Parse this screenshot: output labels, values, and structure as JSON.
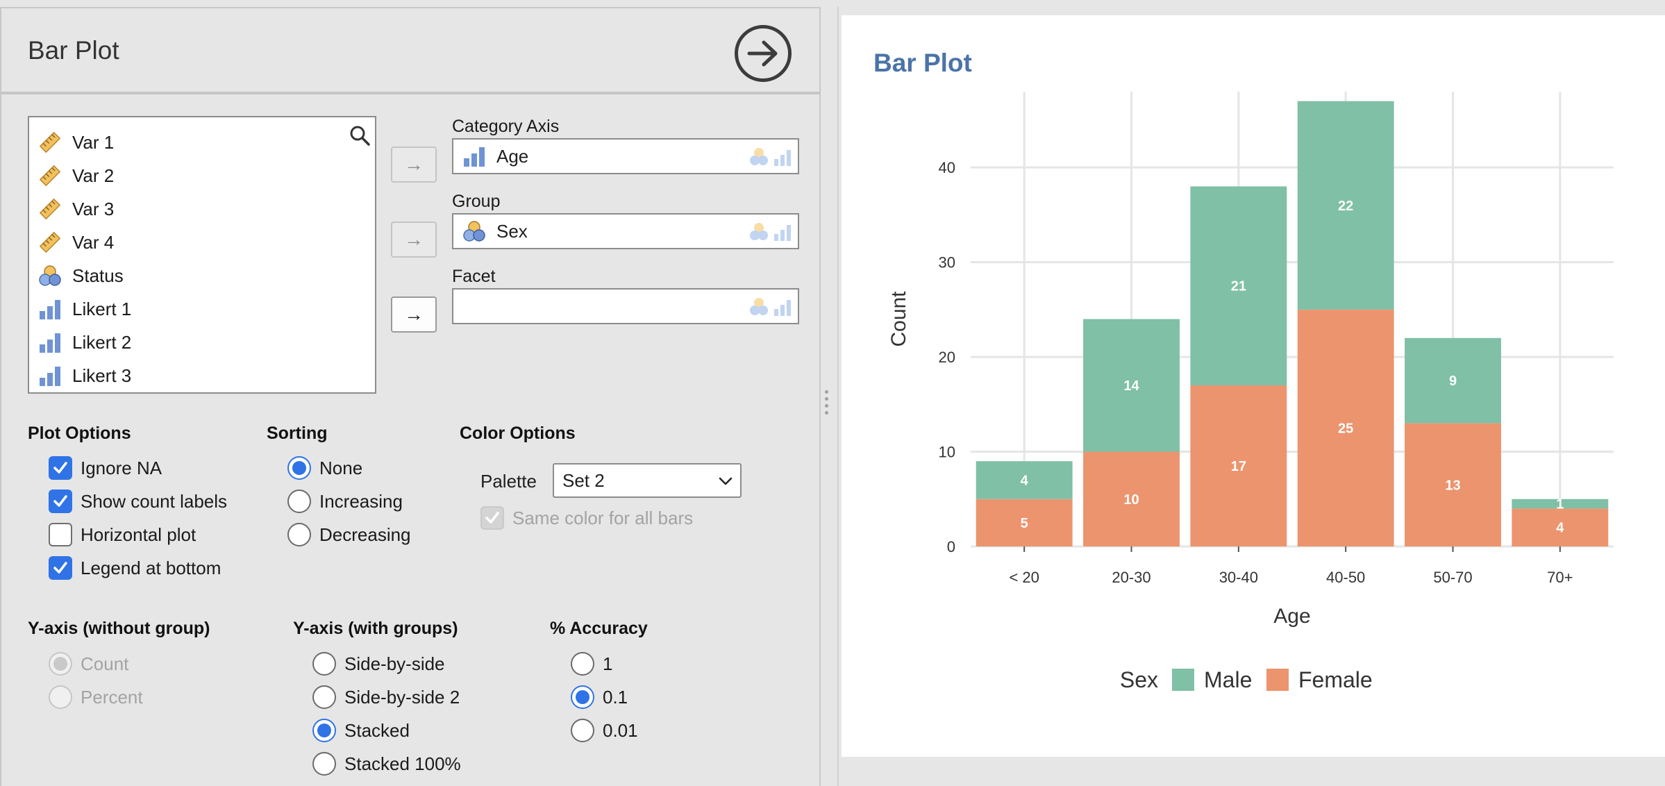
{
  "analysis_title": "Bar Plot",
  "variables": [
    {
      "label": "Var 1",
      "icon": "ruler-icon"
    },
    {
      "label": "Var 2",
      "icon": "ruler-icon"
    },
    {
      "label": "Var 3",
      "icon": "ruler-icon"
    },
    {
      "label": "Var 4",
      "icon": "ruler-icon"
    },
    {
      "label": "Status",
      "icon": "nominal-icon"
    },
    {
      "label": "Likert 1",
      "icon": "ordinal-icon"
    },
    {
      "label": "Likert 2",
      "icon": "ordinal-icon"
    },
    {
      "label": "Likert 3",
      "icon": "ordinal-icon"
    }
  ],
  "targets": {
    "category_axis": {
      "label": "Category Axis",
      "value": "Age",
      "icon": "ordinal-icon"
    },
    "group": {
      "label": "Group",
      "value": "Sex",
      "icon": "nominal-icon"
    },
    "facet": {
      "label": "Facet",
      "value": ""
    }
  },
  "plot_options": {
    "title": "Plot Options",
    "items": [
      {
        "label": "Ignore NA",
        "checked": true
      },
      {
        "label": "Show count labels",
        "checked": true
      },
      {
        "label": "Horizontal plot",
        "checked": false
      },
      {
        "label": "Legend at bottom",
        "checked": true
      }
    ]
  },
  "sorting": {
    "title": "Sorting",
    "options": [
      "None",
      "Increasing",
      "Decreasing"
    ],
    "selected": "None"
  },
  "color_options": {
    "title": "Color Options",
    "palette_label": "Palette",
    "palette_value": "Set 2",
    "same_color_label": "Same color for all bars",
    "same_color_checked": true,
    "same_color_disabled": true
  },
  "y_axis_without_group": {
    "title": "Y-axis (without group)",
    "options": [
      "Count",
      "Percent"
    ],
    "selected": "Count",
    "disabled": true
  },
  "y_axis_with_groups": {
    "title": "Y-axis (with groups)",
    "options": [
      "Side-by-side",
      "Side-by-side 2",
      "Stacked",
      "Stacked 100%"
    ],
    "selected": "Stacked"
  },
  "accuracy": {
    "title": "% Accuracy",
    "options": [
      "1",
      "0.1",
      "0.01"
    ],
    "selected": "0.1"
  },
  "output": {
    "title": "Bar Plot"
  },
  "colors": {
    "male": "#7fc0a6",
    "female": "#ec946e",
    "accent": "#2f73e6",
    "output_title": "#4a73a8"
  },
  "chart_data": {
    "type": "bar",
    "stacked": true,
    "categories": [
      "< 20",
      "20-30",
      "30-40",
      "40-50",
      "50-70",
      "70+"
    ],
    "series": [
      {
        "name": "Female",
        "values": [
          5,
          10,
          17,
          25,
          13,
          4
        ]
      },
      {
        "name": "Male",
        "values": [
          4,
          14,
          21,
          22,
          9,
          1
        ]
      }
    ],
    "xlabel": "Age",
    "ylabel": "Count",
    "ylim": [
      0,
      48
    ],
    "yticks": [
      0,
      10,
      20,
      30,
      40
    ],
    "legend_title": "Sex",
    "legend_order": [
      "Male",
      "Female"
    ],
    "legend_position": "bottom",
    "grid": true
  }
}
